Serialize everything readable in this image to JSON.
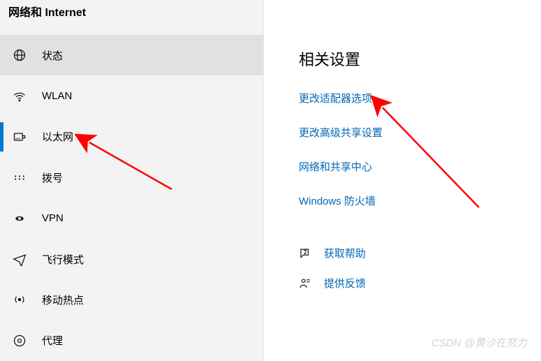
{
  "header": {
    "title": "网络和 Internet"
  },
  "sidebar": {
    "items": [
      {
        "label": "状态",
        "icon": "globe-icon"
      },
      {
        "label": "WLAN",
        "icon": "wifi-icon"
      },
      {
        "label": "以太网",
        "icon": "ethernet-icon"
      },
      {
        "label": "拨号",
        "icon": "dialup-icon"
      },
      {
        "label": "VPN",
        "icon": "vpn-icon"
      },
      {
        "label": "飞行模式",
        "icon": "airplane-icon"
      },
      {
        "label": "移动热点",
        "icon": "hotspot-icon"
      },
      {
        "label": "代理",
        "icon": "proxy-icon"
      }
    ],
    "activeIndex": 0,
    "selectedIndex": 2
  },
  "main": {
    "section_title": "相关设置",
    "links": [
      "更改适配器选项",
      "更改高级共享设置",
      "网络和共享中心",
      "Windows 防火墙"
    ],
    "help": [
      {
        "label": "获取帮助",
        "icon": "help-icon"
      },
      {
        "label": "提供反馈",
        "icon": "feedback-icon"
      }
    ]
  },
  "watermark": "CSDN @黄沙在努力",
  "colors": {
    "accent": "#0078d4",
    "link": "#0066b4",
    "arrow": "#ff0000",
    "sidebarBg": "#f3f3f3"
  }
}
